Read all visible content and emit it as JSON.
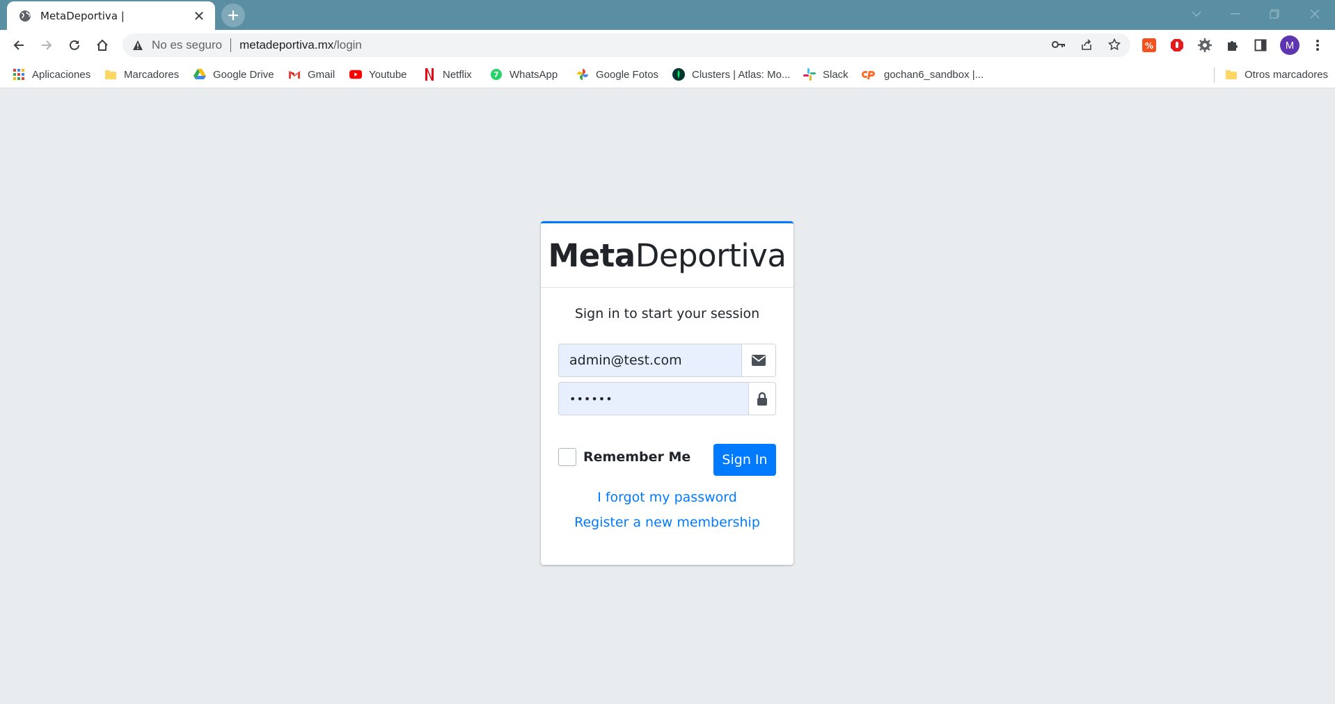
{
  "browser": {
    "tab_title": "MetaDeportiva |",
    "insecure_label": "No es seguro",
    "url_host": "metadeportiva.mx",
    "url_path": "/login",
    "profile_initial": "M"
  },
  "bookmarks": {
    "items": [
      {
        "label": "Aplicaciones",
        "icon": "apps-grid-icon"
      },
      {
        "label": "Marcadores",
        "icon": "folder-icon"
      },
      {
        "label": "Google Drive",
        "icon": "google-drive-icon"
      },
      {
        "label": "Gmail",
        "icon": "gmail-icon"
      },
      {
        "label": "Youtube",
        "icon": "youtube-icon"
      },
      {
        "label": "Netflix",
        "icon": "netflix-icon"
      },
      {
        "label": "WhatsApp",
        "icon": "whatsapp-icon"
      },
      {
        "label": "Google Fotos",
        "icon": "google-photos-icon"
      },
      {
        "label": "Clusters | Atlas: Mo...",
        "icon": "mongodb-icon"
      },
      {
        "label": "Slack",
        "icon": "slack-icon"
      },
      {
        "label": "gochan6_sandbox |...",
        "icon": "cpanel-icon"
      }
    ],
    "other_label": "Otros marcadores"
  },
  "login": {
    "brand_bold": "Meta",
    "brand_regular": "Deportiva",
    "message": "Sign in to start your session",
    "email_value": "admin@test.com",
    "password_value": "••••••",
    "remember_label": "Remember Me",
    "sign_in_label": "Sign In",
    "forgot_label": "I forgot my password",
    "register_label": "Register a new membership"
  },
  "colors": {
    "primary": "#007bff",
    "page_background": "#e9ecef",
    "titlebar": "#5a8fa3",
    "autofill": "#e8f0fe"
  }
}
